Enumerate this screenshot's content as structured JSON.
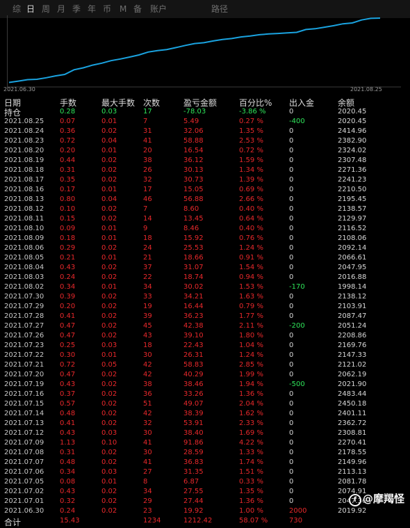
{
  "tabs": [
    {
      "label": "综",
      "active": false
    },
    {
      "label": "日",
      "active": true
    },
    {
      "label": "周",
      "active": false
    },
    {
      "label": "月",
      "active": false
    },
    {
      "label": "季",
      "active": false
    },
    {
      "label": "年",
      "active": false
    },
    {
      "label": "币",
      "active": false
    },
    {
      "label": "M",
      "active": false
    },
    {
      "label": "备",
      "active": false
    },
    {
      "label": "账户",
      "active": false
    },
    {
      "label": "路径",
      "active": false
    }
  ],
  "chart": {
    "start_label": "2021.06.30",
    "end_label": "2021.08.25",
    "line_color": "#1aa3e0"
  },
  "colors": {
    "red": "#e8282b",
    "green": "#2fe65a",
    "blue": "#1aa3e0"
  },
  "chart_data": {
    "type": "line",
    "title": "",
    "x": [
      "2021.06.30",
      "2021.07.01",
      "2021.07.02",
      "2021.07.05",
      "2021.07.06",
      "2021.07.07",
      "2021.07.08",
      "2021.07.09",
      "2021.07.12",
      "2021.07.13",
      "2021.07.14",
      "2021.07.15",
      "2021.07.16",
      "2021.07.19",
      "2021.07.20",
      "2021.07.21",
      "2021.07.22",
      "2021.07.23",
      "2021.07.26",
      "2021.07.27",
      "2021.07.28",
      "2021.07.29",
      "2021.07.30",
      "2021.08.02",
      "2021.08.03",
      "2021.08.04",
      "2021.08.05",
      "2021.08.06",
      "2021.08.09",
      "2021.08.10",
      "2021.08.11",
      "2021.08.12",
      "2021.08.13",
      "2021.08.16",
      "2021.08.17",
      "2021.08.18",
      "2021.08.19",
      "2021.08.20",
      "2021.08.23",
      "2021.08.24",
      "2021.08.25"
    ],
    "series": [
      {
        "values": [
          19.92,
          47.36,
          74.91,
          81.78,
          113.13,
          149.96,
          178.55,
          270.41,
          308.81,
          362.72,
          401.11,
          450.18,
          483.44,
          521.9,
          562.19,
          621.02,
          647.33,
          669.76,
          708.86,
          751.24,
          787.47,
          803.91,
          838.12,
          868.14,
          886.88,
          917.95,
          936.61,
          962.14,
          978.06,
          986.52,
          999.97,
          1008.57,
          1065.43,
          1080.5,
          1111.23,
          1141.36,
          1177.48,
          1194.02,
          1252.9,
          1284.96,
          1290.45
        ]
      }
    ],
    "xlabel": "",
    "ylabel": ""
  },
  "table": {
    "headers": {
      "date": "日期",
      "hands": "手数",
      "max_hands": "最大手数",
      "count": "次数",
      "pnl": "盈亏金额",
      "pct": "百分比%",
      "flow": "出入金",
      "balance": "余额"
    },
    "holding": {
      "label": "持仓",
      "hands": "0.28",
      "max_hands": "0.03",
      "count": "17",
      "pnl": "-78.03",
      "pct": "-3.86 %",
      "flow": "0",
      "balance": "2020.45"
    },
    "rows": [
      {
        "date": "2021.08.25",
        "hands": "0.07",
        "max_hands": "0.01",
        "count": "7",
        "pnl": "5.49",
        "pct": "0.27 %",
        "flow": "-400",
        "balance": "2020.45"
      },
      {
        "date": "2021.08.24",
        "hands": "0.36",
        "max_hands": "0.02",
        "count": "31",
        "pnl": "32.06",
        "pct": "1.35 %",
        "flow": "0",
        "balance": "2414.96"
      },
      {
        "date": "2021.08.23",
        "hands": "0.72",
        "max_hands": "0.04",
        "count": "41",
        "pnl": "58.88",
        "pct": "2.53 %",
        "flow": "0",
        "balance": "2382.90"
      },
      {
        "date": "2021.08.20",
        "hands": "0.20",
        "max_hands": "0.01",
        "count": "20",
        "pnl": "16.54",
        "pct": "0.72 %",
        "flow": "0",
        "balance": "2324.02"
      },
      {
        "date": "2021.08.19",
        "hands": "0.44",
        "max_hands": "0.02",
        "count": "38",
        "pnl": "36.12",
        "pct": "1.59 %",
        "flow": "0",
        "balance": "2307.48"
      },
      {
        "date": "2021.08.18",
        "hands": "0.31",
        "max_hands": "0.02",
        "count": "26",
        "pnl": "30.13",
        "pct": "1.34 %",
        "flow": "0",
        "balance": "2271.36"
      },
      {
        "date": "2021.08.17",
        "hands": "0.35",
        "max_hands": "0.02",
        "count": "32",
        "pnl": "30.73",
        "pct": "1.39 %",
        "flow": "0",
        "balance": "2241.23"
      },
      {
        "date": "2021.08.16",
        "hands": "0.17",
        "max_hands": "0.01",
        "count": "17",
        "pnl": "15.05",
        "pct": "0.69 %",
        "flow": "0",
        "balance": "2210.50"
      },
      {
        "date": "2021.08.13",
        "hands": "0.80",
        "max_hands": "0.04",
        "count": "46",
        "pnl": "56.88",
        "pct": "2.66 %",
        "flow": "0",
        "balance": "2195.45"
      },
      {
        "date": "2021.08.12",
        "hands": "0.10",
        "max_hands": "0.02",
        "count": "7",
        "pnl": "8.60",
        "pct": "0.40 %",
        "flow": "0",
        "balance": "2138.57"
      },
      {
        "date": "2021.08.11",
        "hands": "0.15",
        "max_hands": "0.02",
        "count": "14",
        "pnl": "13.45",
        "pct": "0.64 %",
        "flow": "0",
        "balance": "2129.97"
      },
      {
        "date": "2021.08.10",
        "hands": "0.09",
        "max_hands": "0.01",
        "count": "9",
        "pnl": "8.46",
        "pct": "0.40 %",
        "flow": "0",
        "balance": "2116.52"
      },
      {
        "date": "2021.08.09",
        "hands": "0.18",
        "max_hands": "0.01",
        "count": "18",
        "pnl": "15.92",
        "pct": "0.76 %",
        "flow": "0",
        "balance": "2108.06"
      },
      {
        "date": "2021.08.06",
        "hands": "0.29",
        "max_hands": "0.02",
        "count": "24",
        "pnl": "25.53",
        "pct": "1.24 %",
        "flow": "0",
        "balance": "2092.14"
      },
      {
        "date": "2021.08.05",
        "hands": "0.21",
        "max_hands": "0.01",
        "count": "21",
        "pnl": "18.66",
        "pct": "0.91 %",
        "flow": "0",
        "balance": "2066.61"
      },
      {
        "date": "2021.08.04",
        "hands": "0.43",
        "max_hands": "0.02",
        "count": "37",
        "pnl": "31.07",
        "pct": "1.54 %",
        "flow": "0",
        "balance": "2047.95"
      },
      {
        "date": "2021.08.03",
        "hands": "0.24",
        "max_hands": "0.02",
        "count": "22",
        "pnl": "18.74",
        "pct": "0.94 %",
        "flow": "0",
        "balance": "2016.88"
      },
      {
        "date": "2021.08.02",
        "hands": "0.34",
        "max_hands": "0.01",
        "count": "34",
        "pnl": "30.02",
        "pct": "1.53 %",
        "flow": "-170",
        "balance": "1998.14"
      },
      {
        "date": "2021.07.30",
        "hands": "0.39",
        "max_hands": "0.02",
        "count": "33",
        "pnl": "34.21",
        "pct": "1.63 %",
        "flow": "0",
        "balance": "2138.12"
      },
      {
        "date": "2021.07.29",
        "hands": "0.20",
        "max_hands": "0.02",
        "count": "19",
        "pnl": "16.44",
        "pct": "0.79 %",
        "flow": "0",
        "balance": "2103.91"
      },
      {
        "date": "2021.07.28",
        "hands": "0.41",
        "max_hands": "0.02",
        "count": "39",
        "pnl": "36.23",
        "pct": "1.77 %",
        "flow": "0",
        "balance": "2087.47"
      },
      {
        "date": "2021.07.27",
        "hands": "0.47",
        "max_hands": "0.02",
        "count": "45",
        "pnl": "42.38",
        "pct": "2.11 %",
        "flow": "-200",
        "balance": "2051.24"
      },
      {
        "date": "2021.07.26",
        "hands": "0.47",
        "max_hands": "0.02",
        "count": "43",
        "pnl": "39.10",
        "pct": "1.80 %",
        "flow": "0",
        "balance": "2208.86"
      },
      {
        "date": "2021.07.23",
        "hands": "0.25",
        "max_hands": "0.03",
        "count": "18",
        "pnl": "22.43",
        "pct": "1.04 %",
        "flow": "0",
        "balance": "2169.76"
      },
      {
        "date": "2021.07.22",
        "hands": "0.30",
        "max_hands": "0.01",
        "count": "30",
        "pnl": "26.31",
        "pct": "1.24 %",
        "flow": "0",
        "balance": "2147.33"
      },
      {
        "date": "2021.07.21",
        "hands": "0.72",
        "max_hands": "0.05",
        "count": "42",
        "pnl": "58.83",
        "pct": "2.85 %",
        "flow": "0",
        "balance": "2121.02"
      },
      {
        "date": "2021.07.20",
        "hands": "0.47",
        "max_hands": "0.02",
        "count": "42",
        "pnl": "40.29",
        "pct": "1.99 %",
        "flow": "0",
        "balance": "2062.19"
      },
      {
        "date": "2021.07.19",
        "hands": "0.43",
        "max_hands": "0.02",
        "count": "38",
        "pnl": "38.46",
        "pct": "1.94 %",
        "flow": "-500",
        "balance": "2021.90"
      },
      {
        "date": "2021.07.16",
        "hands": "0.37",
        "max_hands": "0.02",
        "count": "36",
        "pnl": "33.26",
        "pct": "1.36 %",
        "flow": "0",
        "balance": "2483.44"
      },
      {
        "date": "2021.07.15",
        "hands": "0.57",
        "max_hands": "0.02",
        "count": "51",
        "pnl": "49.07",
        "pct": "2.04 %",
        "flow": "0",
        "balance": "2450.18"
      },
      {
        "date": "2021.07.14",
        "hands": "0.48",
        "max_hands": "0.02",
        "count": "42",
        "pnl": "38.39",
        "pct": "1.62 %",
        "flow": "0",
        "balance": "2401.11"
      },
      {
        "date": "2021.07.13",
        "hands": "0.41",
        "max_hands": "0.02",
        "count": "32",
        "pnl": "53.91",
        "pct": "2.33 %",
        "flow": "0",
        "balance": "2362.72"
      },
      {
        "date": "2021.07.12",
        "hands": "0.43",
        "max_hands": "0.03",
        "count": "30",
        "pnl": "38.40",
        "pct": "1.69 %",
        "flow": "0",
        "balance": "2308.81"
      },
      {
        "date": "2021.07.09",
        "hands": "1.13",
        "max_hands": "0.10",
        "count": "41",
        "pnl": "91.86",
        "pct": "4.22 %",
        "flow": "0",
        "balance": "2270.41"
      },
      {
        "date": "2021.07.08",
        "hands": "0.31",
        "max_hands": "0.02",
        "count": "30",
        "pnl": "28.59",
        "pct": "1.33 %",
        "flow": "0",
        "balance": "2178.55"
      },
      {
        "date": "2021.07.07",
        "hands": "0.48",
        "max_hands": "0.02",
        "count": "41",
        "pnl": "36.83",
        "pct": "1.74 %",
        "flow": "0",
        "balance": "2149.96"
      },
      {
        "date": "2021.07.06",
        "hands": "0.34",
        "max_hands": "0.03",
        "count": "27",
        "pnl": "31.35",
        "pct": "1.51 %",
        "flow": "0",
        "balance": "2113.13"
      },
      {
        "date": "2021.07.05",
        "hands": "0.08",
        "max_hands": "0.01",
        "count": "8",
        "pnl": "6.87",
        "pct": "0.33 %",
        "flow": "0",
        "balance": "2081.78"
      },
      {
        "date": "2021.07.02",
        "hands": "0.43",
        "max_hands": "0.02",
        "count": "34",
        "pnl": "27.55",
        "pct": "1.35 %",
        "flow": "0",
        "balance": "2074.91"
      },
      {
        "date": "2021.07.01",
        "hands": "0.32",
        "max_hands": "0.02",
        "count": "29",
        "pnl": "27.44",
        "pct": "1.36 %",
        "flow": "0",
        "balance": "2047.36"
      },
      {
        "date": "2021.06.30",
        "hands": "0.24",
        "max_hands": "0.02",
        "count": "23",
        "pnl": "19.92",
        "pct": "1.00 %",
        "flow": "2000",
        "balance": "2019.92"
      }
    ],
    "total": {
      "label": "合计",
      "hands": "15.43",
      "max_hands": "",
      "count": "1234",
      "pnl": "1212.42",
      "pct": "58.07 %",
      "flow": "730",
      "balance": ""
    }
  },
  "watermark": {
    "logo": "f",
    "text": "@摩羯怪"
  }
}
